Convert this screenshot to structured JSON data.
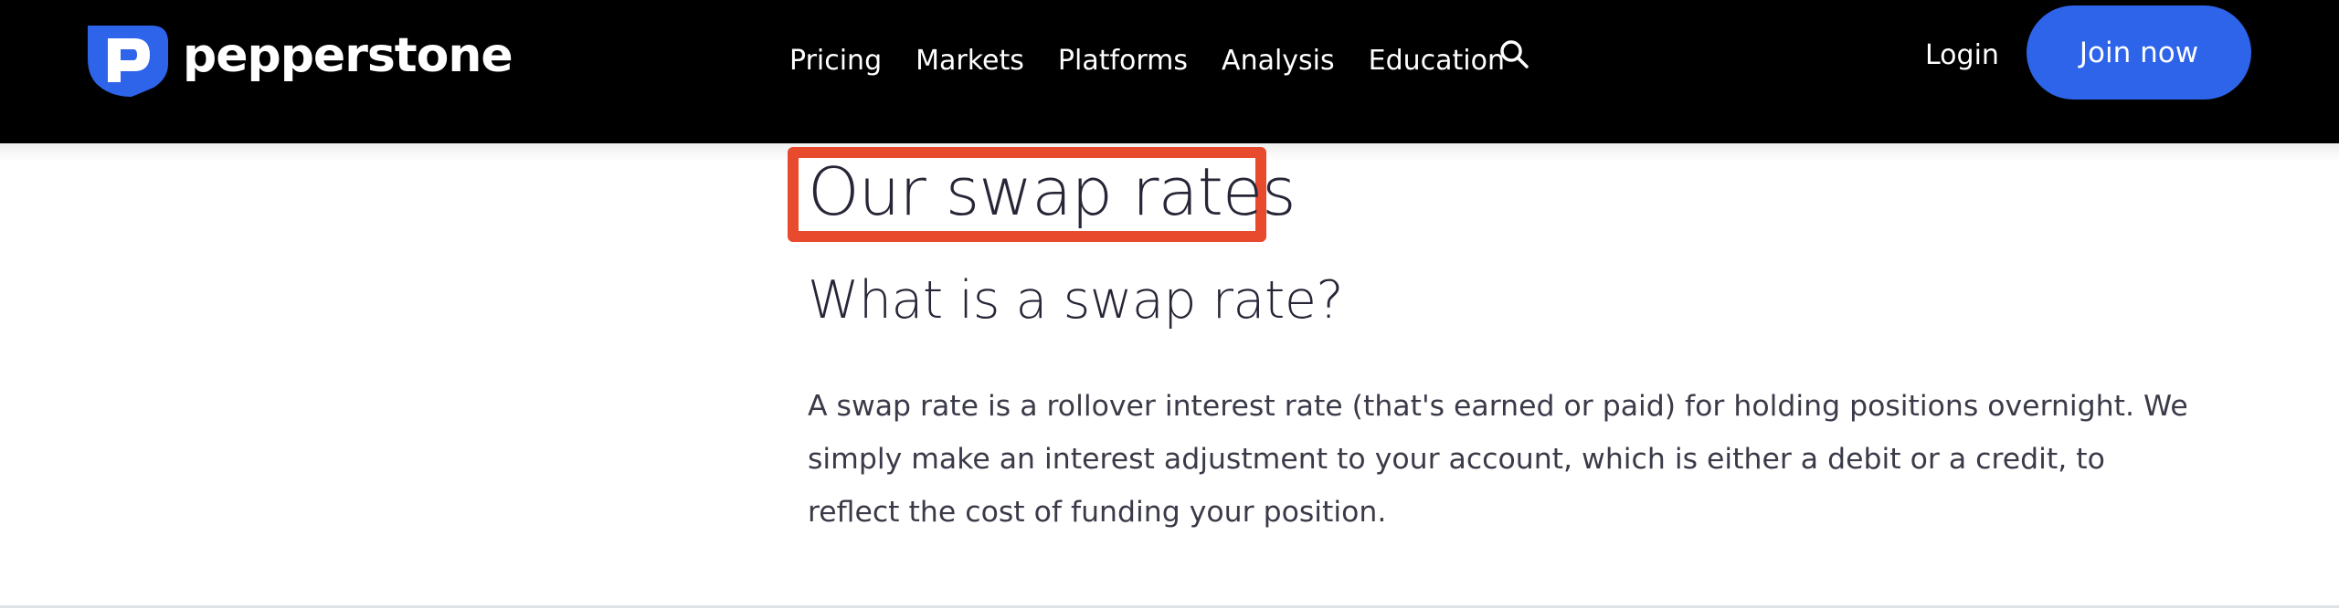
{
  "brand": {
    "name": "pepperstone",
    "accent": "#2d64ea"
  },
  "nav": {
    "items": [
      {
        "label": "Pricing"
      },
      {
        "label": "Markets"
      },
      {
        "label": "Platforms"
      },
      {
        "label": "Analysis"
      },
      {
        "label": "Education"
      }
    ],
    "search_icon": "search-icon"
  },
  "header_actions": {
    "login_label": "Login",
    "join_label": "Join now"
  },
  "content": {
    "title": "Our swap rates",
    "subtitle": "What is a swap rate?",
    "body": "A swap rate is a rollover interest rate (that's earned or paid) for holding positions overnight. We simply make an interest adjustment to your account, which is either a debit or a credit, to reflect the cost of funding your position."
  },
  "highlight_color": "#e84a2e"
}
